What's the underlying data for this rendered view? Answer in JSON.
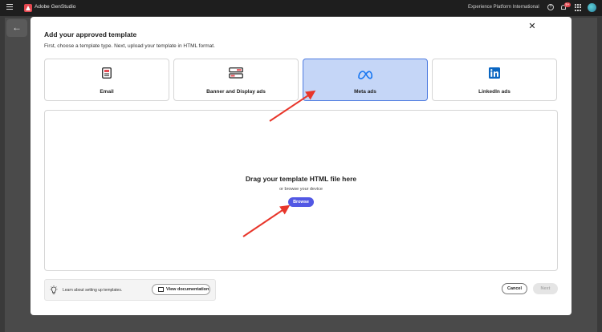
{
  "app": {
    "name": "Adobe GenStudio",
    "org": "Experience Platform International",
    "notification_count": "9+",
    "accent_color": "#5258e4"
  },
  "modal": {
    "title": "Add your approved template",
    "subtitle": "First, choose a template type. Next, upload your template in HTML format.",
    "template_types": [
      {
        "label": "Email",
        "icon": "email-template-icon",
        "selected": false
      },
      {
        "label": "Banner and Display ads",
        "icon": "banner-template-icon",
        "selected": false
      },
      {
        "label": "Meta ads",
        "icon": "meta-logo-icon",
        "selected": true
      },
      {
        "label": "LinkedIn ads",
        "icon": "linkedin-logo-icon",
        "selected": false
      }
    ],
    "dropzone": {
      "title": "Drag your template HTML file here",
      "subtitle": "or browse your device",
      "browse_label": "Browse"
    },
    "footer": {
      "learn_text": "Learn about setting up templates.",
      "view_doc_label": "View documentation",
      "cancel_label": "Cancel",
      "next_label": "Next"
    }
  }
}
